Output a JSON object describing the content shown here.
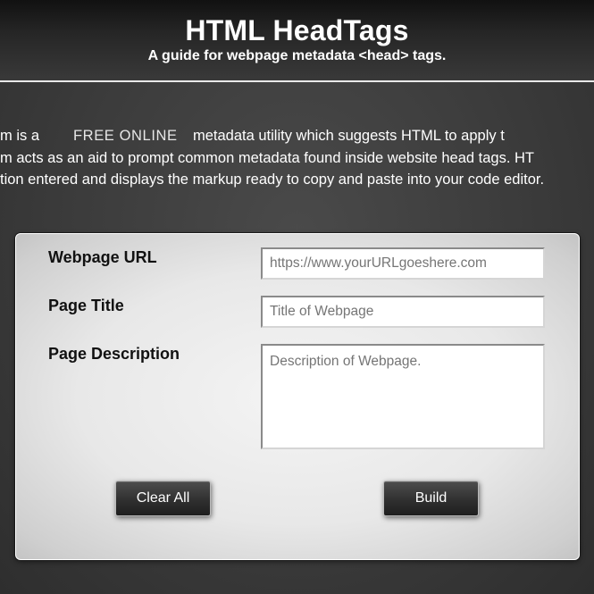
{
  "header": {
    "title": "HTML HeadTags",
    "subtitle": "A guide for webpage metadata <head> tags."
  },
  "intro": {
    "line1_start": "m is a",
    "line1_highlight": "FREE ONLINE",
    "line1_end": "metadata utility which suggests HTML to apply t",
    "line2": "m acts as an aid to prompt common metadata found inside website head tags. HT",
    "line3": "tion entered and displays the markup ready to copy and paste into your code editor."
  },
  "form": {
    "url_label": "Webpage URL",
    "url_placeholder": "https://www.yourURLgoeshere.com",
    "title_label": "Page Title",
    "title_placeholder": "Title of Webpage",
    "description_label": "Page Description",
    "description_placeholder": "Description of Webpage.",
    "clear_label": "Clear All",
    "build_label": "Build"
  },
  "colors": {
    "background": "#3a3a3a",
    "header_dark": "#111111",
    "card": "#e8e8e8",
    "button": "#303030"
  }
}
